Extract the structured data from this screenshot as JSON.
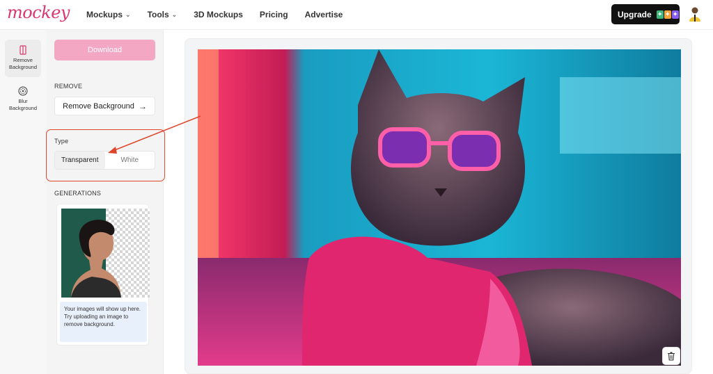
{
  "brand": {
    "logo_text": "mockey",
    "color": "#d9376e"
  },
  "nav": {
    "items": [
      {
        "label": "Mockups",
        "has_dropdown": true
      },
      {
        "label": "Tools",
        "has_dropdown": true
      },
      {
        "label": "3D Mockups",
        "has_dropdown": false
      },
      {
        "label": "Pricing",
        "has_dropdown": false
      },
      {
        "label": "Advertise",
        "has_dropdown": false
      }
    ],
    "upgrade_label": "Upgrade"
  },
  "rail": {
    "items": [
      {
        "label": "Remove Background",
        "icon": "remove-background-icon",
        "active": true
      },
      {
        "label": "Blur Background",
        "icon": "blur-background-icon",
        "active": false
      }
    ]
  },
  "panel": {
    "download_label": "Download",
    "remove_section": "REMOVE",
    "remove_button": "Remove Background",
    "type_section": "Type",
    "type_options": [
      "Transparent",
      "White"
    ],
    "type_selected": "Transparent",
    "generations_section": "GENERATIONS",
    "generations_note": "Your images will show up here. Try uploading an image to remove background."
  },
  "canvas": {
    "image_subject": "cat-with-pink-sunglasses-photo"
  },
  "colors": {
    "download_bg": "#f4a7c2",
    "highlight": "#e0452c",
    "upgrade_bg": "#111111"
  }
}
